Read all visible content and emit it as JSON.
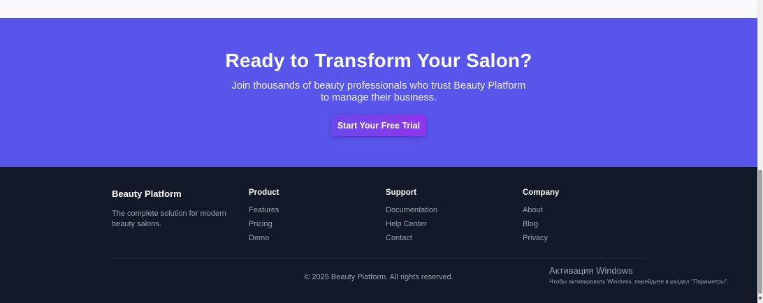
{
  "cta": {
    "title": "Ready to Transform Your Salon?",
    "subtitle": "Join thousands of beauty professionals who trust Beauty Platform to manage their business.",
    "button_label": "Start Your Free Trial"
  },
  "footer": {
    "brand": {
      "name": "Beauty Platform",
      "description": "The complete solution for modern beauty salons."
    },
    "columns": [
      {
        "title": "Product",
        "links": [
          "Features",
          "Pricing",
          "Demo"
        ]
      },
      {
        "title": "Support",
        "links": [
          "Documentation",
          "Help Center",
          "Contact"
        ]
      },
      {
        "title": "Company",
        "links": [
          "About",
          "Blog",
          "Privacy"
        ]
      }
    ],
    "copyright": "© 2025 Beauty Platform. All rights reserved."
  },
  "windows_activation": {
    "title": "Активация Windows",
    "subtitle": "Чтобы активировать Windows, перейдите в раздел \"Параметры\"."
  },
  "colors": {
    "cta_background": "#5855eb",
    "footer_background": "#111827",
    "button_gradient_start": "#6b48ea",
    "button_gradient_end": "#8f36ea"
  }
}
